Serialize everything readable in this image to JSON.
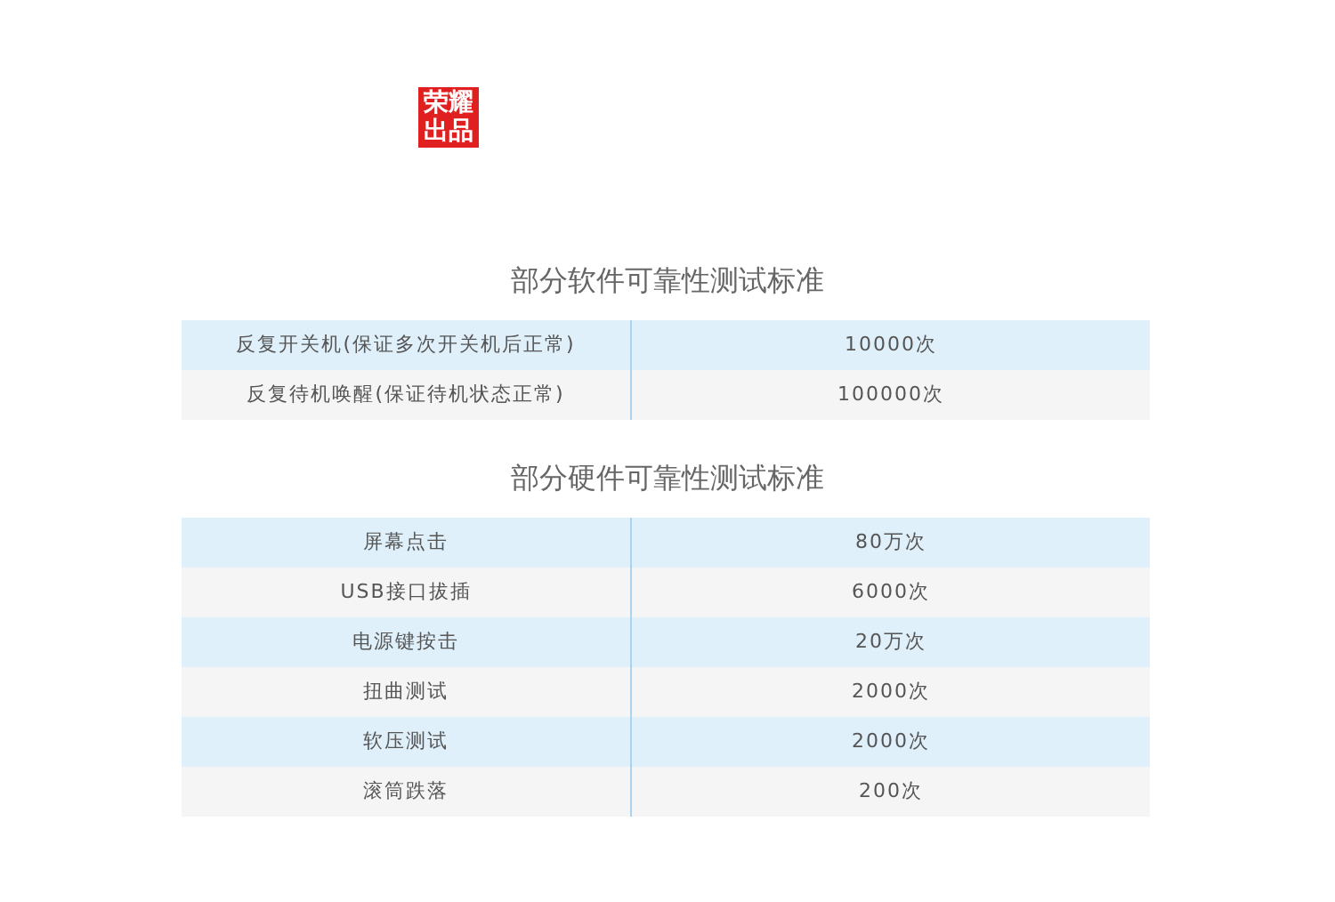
{
  "seal": {
    "text": "荣耀出品"
  },
  "tables": [
    {
      "title": "部分软件可靠性测试标准",
      "rows": [
        {
          "item": "反复开关机(保证多次开关机后正常)",
          "value": "10000次"
        },
        {
          "item": "反复待机唤醒(保证待机状态正常)",
          "value": "100000次"
        }
      ]
    },
    {
      "title": "部分硬件可靠性测试标准",
      "rows": [
        {
          "item": "屏幕点击",
          "value": "80万次"
        },
        {
          "item": "USB接口拔插",
          "value": "6000次"
        },
        {
          "item": "电源键按击",
          "value": "20万次"
        },
        {
          "item": "扭曲测试",
          "value": "2000次"
        },
        {
          "item": "软压测试",
          "value": "2000次"
        },
        {
          "item": "滚筒跌落",
          "value": "200次"
        }
      ]
    }
  ]
}
